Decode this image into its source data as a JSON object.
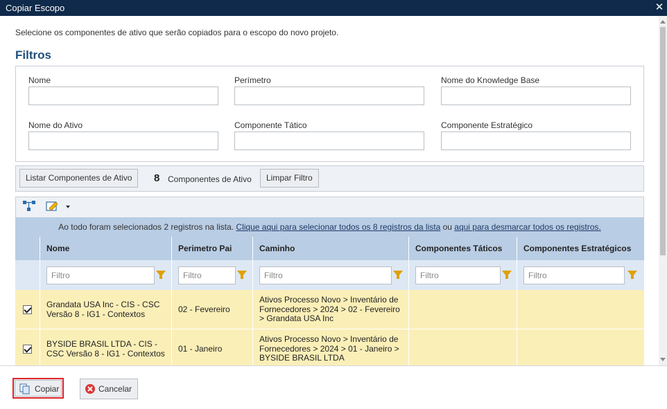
{
  "window": {
    "title": "Copiar Escopo",
    "close_glyph": "✕"
  },
  "intro": "Selecione os componentes de ativo que serão copiados para o escopo do novo projeto.",
  "filters": {
    "title": "Filtros",
    "fields": {
      "nome": "Nome",
      "perimetro": "Perímetro",
      "kb": "Nome do Knowledge Base",
      "ativo": "Nome do Ativo",
      "tatico": "Componente Tático",
      "estrategico": "Componente Estratégico"
    }
  },
  "list_bar": {
    "list_button": "Listar Componentes de Ativo",
    "count": "8",
    "count_label": "Componentes de Ativo",
    "clear_button": "Limpar Filtro"
  },
  "toolbar": {
    "icons": [
      "hierarchy-icon",
      "edit-icon"
    ]
  },
  "selection": {
    "text_prefix": "Ao todo foram selecionados 2 registros na lista. ",
    "select_all_link": "Clique aqui para selecionar todos os 8 registros da lista",
    "middle": " ou ",
    "deselect_link": "aqui para desmarcar todos os registros."
  },
  "grid": {
    "headers": [
      "Nome",
      "Perimetro Pai",
      "Caminho",
      "Componentes Táticos",
      "Componentes Estratégicos"
    ],
    "filter_placeholder": "Filtro",
    "rows": [
      {
        "checked": true,
        "nome": "Grandata USA Inc - CIS - CSC Versão 8 - IG1 - Contextos",
        "perimetro": "02 - Fevereiro",
        "caminho": "Ativos Processo Novo > Inventário de Fornecedores > 2024 > 02 - Fevereiro > Grandata USA Inc",
        "taticos": "",
        "estrategicos": ""
      },
      {
        "checked": true,
        "nome": "BYSIDE BRASIL LTDA - CIS - CSC Versão 8 - IG1 - Contextos",
        "perimetro": "01 - Janeiro",
        "caminho": "Ativos Processo Novo > Inventário de Fornecedores > 2024 > 01 - Janeiro > BYSIDE BRASIL LTDA",
        "taticos": "",
        "estrategicos": ""
      }
    ]
  },
  "footer": {
    "copy_button": "Copiar",
    "cancel_button": "Cancelar"
  },
  "colors": {
    "title_bar": "#0f2a4a",
    "heading": "#1f4e79",
    "grid_header": "#b9cde4",
    "row_selected": "#fbefb8",
    "copy_highlight": "#e0262b"
  }
}
